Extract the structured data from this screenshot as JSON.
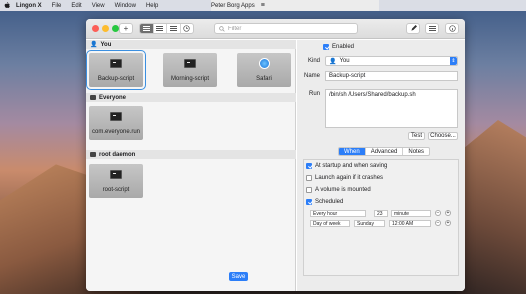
{
  "menubar": {
    "items": [
      "Lingon X",
      "File",
      "Edit",
      "View",
      "Window",
      "Help"
    ],
    "right_label": "Peter Borg Apps"
  },
  "toolbar": {
    "add_label": "+",
    "filter_placeholder": "Filter",
    "filter_value": ""
  },
  "groups": [
    {
      "name": "You",
      "items": [
        {
          "label": "Backup-script",
          "icon": "terminal-icon",
          "selected": true
        },
        {
          "label": "Morning-script",
          "icon": "terminal-icon",
          "selected": false
        },
        {
          "label": "Safari",
          "icon": "safari-icon",
          "selected": false
        }
      ]
    },
    {
      "name": "Everyone",
      "items": [
        {
          "label": "com.everyone.run",
          "icon": "terminal-icon",
          "selected": false
        }
      ]
    },
    {
      "name": "root daemon",
      "items": [
        {
          "label": "root-script",
          "icon": "terminal-icon",
          "selected": false
        }
      ]
    }
  ],
  "detail": {
    "enabled_label": "Enabled",
    "enabled": true,
    "kind_label": "Kind",
    "kind_value": "You",
    "name_label": "Name",
    "name_value": "Backup-script",
    "run_label": "Run",
    "run_value": "/bin/sh /Users/Shared/backup.sh",
    "test_label": "Test",
    "choose_label": "Choose...",
    "tabs": [
      "When",
      "Advanced",
      "Notes"
    ],
    "active_tab": "When",
    "options": [
      {
        "label": "At startup and when saving",
        "checked": true
      },
      {
        "label": "Launch again if it crashes",
        "checked": false
      },
      {
        "label": "A volume is mounted",
        "checked": false
      },
      {
        "label": "Scheduled",
        "checked": true
      }
    ],
    "schedule": [
      {
        "period": "Every hour",
        "value": "23",
        "unit": "minute"
      },
      {
        "period": "Day of week",
        "value": "Sunday",
        "unit": "12:00 AM"
      }
    ],
    "help_label": "?",
    "save_label": "Save"
  },
  "colors": {
    "accent": "#2c7ef8",
    "close": "#fc5f57",
    "minimize": "#fdbc2e",
    "maximize": "#28c840"
  }
}
